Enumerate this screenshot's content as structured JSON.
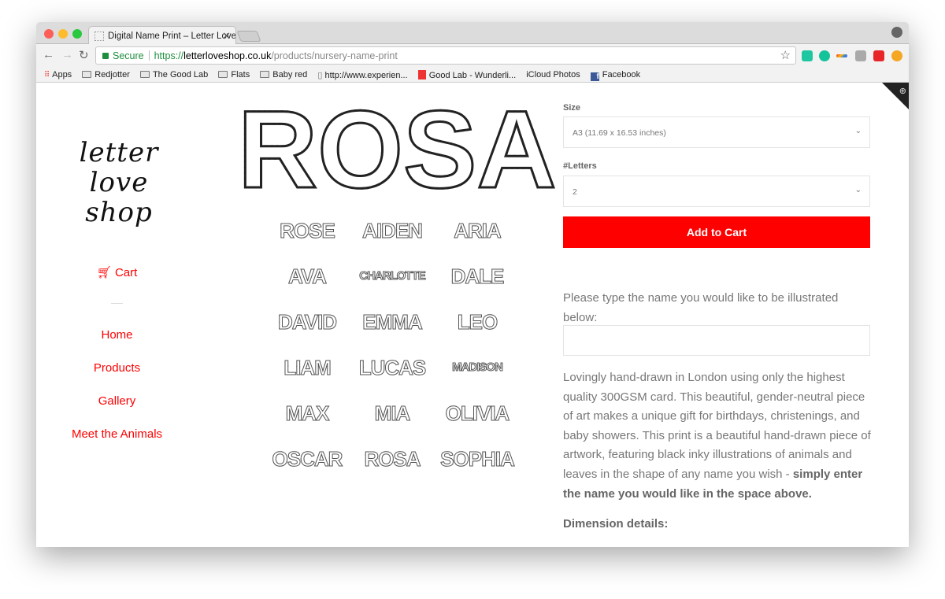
{
  "browser": {
    "tab_title": "Digital Name Print – Letter Love Shop",
    "url_secure": "Secure",
    "url_scheme": "https://",
    "url_host": "letterloveshop.co.uk",
    "url_path": "/products/nursery-name-print",
    "bookmarks": [
      "Apps",
      "Redjotter",
      "The Good Lab",
      "Flats",
      "Baby red",
      "http://www.experien...",
      "Good Lab - Wunderli...",
      "iCloud Photos",
      "Facebook"
    ],
    "extension_colors": [
      "#1fc7a0",
      "#15c39a",
      "#3b7be0",
      "#aaaaaa",
      "#e8262a",
      "#f5a623"
    ]
  },
  "sidebar": {
    "logo": "letter love shop",
    "cart": "Cart",
    "items": [
      "Home",
      "Products",
      "Gallery",
      "Meet the Animals"
    ]
  },
  "gallery": {
    "hero": [
      "R",
      "O",
      "S",
      "A"
    ],
    "names": [
      "ROSE",
      "AIDEN",
      "ARIA",
      "AVA",
      "CHARLOTTE",
      "DALE",
      "DAVID",
      "EMMA",
      "LEO",
      "LIAM",
      "LUCAS",
      "MADISON",
      "MAX",
      "MIA",
      "OLIVIA",
      "OSCAR",
      "ROSA",
      "SOPHIA"
    ]
  },
  "product": {
    "size_label": "Size",
    "size_value": "A3 (11.69 x 16.53 inches)",
    "letters_label": "#Letters",
    "letters_value": "2",
    "add_to_cart": "Add to Cart",
    "prompt": "Please type the name you would like to be illustrated below:",
    "name_value": "",
    "description": "Lovingly hand-drawn in London using only the highest quality 300GSM card. This beautiful, gender-neutral piece of art makes a unique gift for birthdays, christenings, and baby showers. This print is a beautiful hand-drawn piece of artwork, featuring black inky illustrations of animals and leaves in the shape of any name you wish - ",
    "description_bold": "simply enter the name you would like in the space above.",
    "dimension_heading": "Dimension details:"
  },
  "accent_color": "#ff0000"
}
